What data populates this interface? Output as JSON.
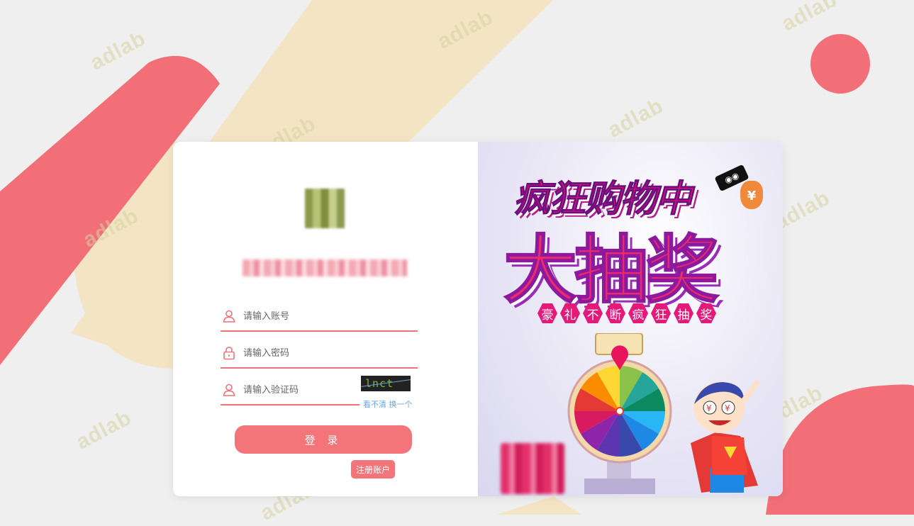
{
  "watermark_text": "adlab",
  "login": {
    "logo_icon": "site-logo-icon",
    "site_title": "",
    "account_placeholder": "请输入账号",
    "password_placeholder": "请输入密码",
    "captcha_placeholder": "请输入验证码",
    "captcha_image_text": "lnct",
    "captcha_refresh": "看不清 换一个",
    "login_button": "登 录",
    "register_button": "注册账户"
  },
  "promo": {
    "headline_line1": "疯狂购物中",
    "headline_line2": "大抽奖",
    "subtitle_chars": [
      "豪",
      "礼",
      "不",
      "断",
      "疯",
      "狂",
      "抽",
      "奖"
    ],
    "money_symbol": "¥"
  },
  "colors": {
    "accent": "#f37479",
    "link": "#6aa5e0",
    "background": "#efefef",
    "stripe_beige": "#f3e5c4",
    "stripe_coral": "#f26f78"
  }
}
